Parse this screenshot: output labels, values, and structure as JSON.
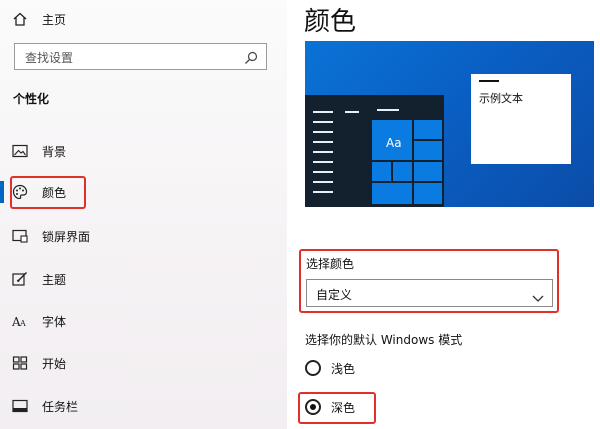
{
  "sidebar": {
    "home_label": "主页",
    "search_placeholder": "查找设置",
    "section_title": "个性化",
    "items": [
      {
        "label": "背景",
        "icon": "image-icon"
      },
      {
        "label": "颜色",
        "icon": "palette-icon"
      },
      {
        "label": "锁屏界面",
        "icon": "lock-screen-icon"
      },
      {
        "label": "主题",
        "icon": "theme-icon"
      },
      {
        "label": "字体",
        "icon": "font-icon"
      },
      {
        "label": "开始",
        "icon": "start-icon"
      },
      {
        "label": "任务栏",
        "icon": "taskbar-icon"
      }
    ]
  },
  "main": {
    "title": "颜色",
    "preview": {
      "tile_text": "Aa",
      "sample_text": "示例文本"
    },
    "choose_color_label": "选择颜色",
    "choose_color_value": "自定义",
    "mode_label": "选择你的默认 Windows 模式",
    "modes": [
      {
        "label": "浅色",
        "checked": false
      },
      {
        "label": "深色",
        "checked": true
      }
    ]
  },
  "colors": {
    "accent": "#0067c0",
    "highlight_box": "#e0302a",
    "preview_blue": "#0a73d6"
  }
}
